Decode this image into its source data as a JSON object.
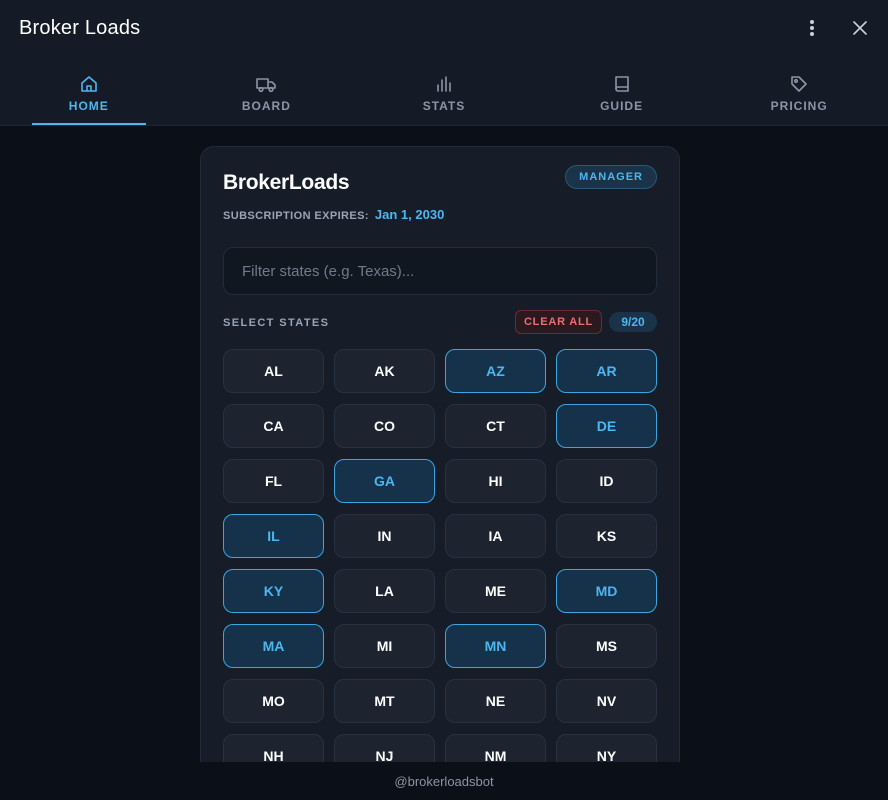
{
  "window": {
    "title": "Broker Loads",
    "menu_icon": "more-vertical-icon",
    "close_icon": "close-icon"
  },
  "tabs": [
    {
      "label": "HOME",
      "icon": "home-icon",
      "active": true
    },
    {
      "label": "BOARD",
      "icon": "truck-icon",
      "active": false
    },
    {
      "label": "STATS",
      "icon": "bar-chart-icon",
      "active": false
    },
    {
      "label": "GUIDE",
      "icon": "book-icon",
      "active": false
    },
    {
      "label": "PRICING",
      "icon": "tag-icon",
      "active": false
    }
  ],
  "card": {
    "brand": "BrokerLoads",
    "role_badge": "MANAGER",
    "subscription_label": "SUBSCRIPTION EXPIRES:",
    "subscription_date": "Jan 1, 2030",
    "search_placeholder": "Filter states (e.g. Texas)...",
    "search_value": "",
    "select_label": "SELECT STATES",
    "clear_label": "CLEAR ALL",
    "count": "9/20"
  },
  "states": [
    {
      "code": "AL",
      "selected": false
    },
    {
      "code": "AK",
      "selected": false
    },
    {
      "code": "AZ",
      "selected": true
    },
    {
      "code": "AR",
      "selected": true
    },
    {
      "code": "CA",
      "selected": false
    },
    {
      "code": "CO",
      "selected": false
    },
    {
      "code": "CT",
      "selected": false
    },
    {
      "code": "DE",
      "selected": true
    },
    {
      "code": "FL",
      "selected": false
    },
    {
      "code": "GA",
      "selected": true
    },
    {
      "code": "HI",
      "selected": false
    },
    {
      "code": "ID",
      "selected": false
    },
    {
      "code": "IL",
      "selected": true
    },
    {
      "code": "IN",
      "selected": false
    },
    {
      "code": "IA",
      "selected": false
    },
    {
      "code": "KS",
      "selected": false
    },
    {
      "code": "KY",
      "selected": true
    },
    {
      "code": "LA",
      "selected": false
    },
    {
      "code": "ME",
      "selected": false
    },
    {
      "code": "MD",
      "selected": true
    },
    {
      "code": "MA",
      "selected": true
    },
    {
      "code": "MI",
      "selected": false
    },
    {
      "code": "MN",
      "selected": true
    },
    {
      "code": "MS",
      "selected": false
    },
    {
      "code": "MO",
      "selected": false
    },
    {
      "code": "MT",
      "selected": false
    },
    {
      "code": "NE",
      "selected": false
    },
    {
      "code": "NV",
      "selected": false
    },
    {
      "code": "NH",
      "selected": false
    },
    {
      "code": "NJ",
      "selected": false
    },
    {
      "code": "NM",
      "selected": false
    },
    {
      "code": "NY",
      "selected": false
    }
  ],
  "footer": {
    "handle": "@brokerloadsbot"
  },
  "colors": {
    "accent": "#4cb6f0",
    "danger": "#f06b74",
    "background": "#0b0f17",
    "card": "#161d29"
  }
}
